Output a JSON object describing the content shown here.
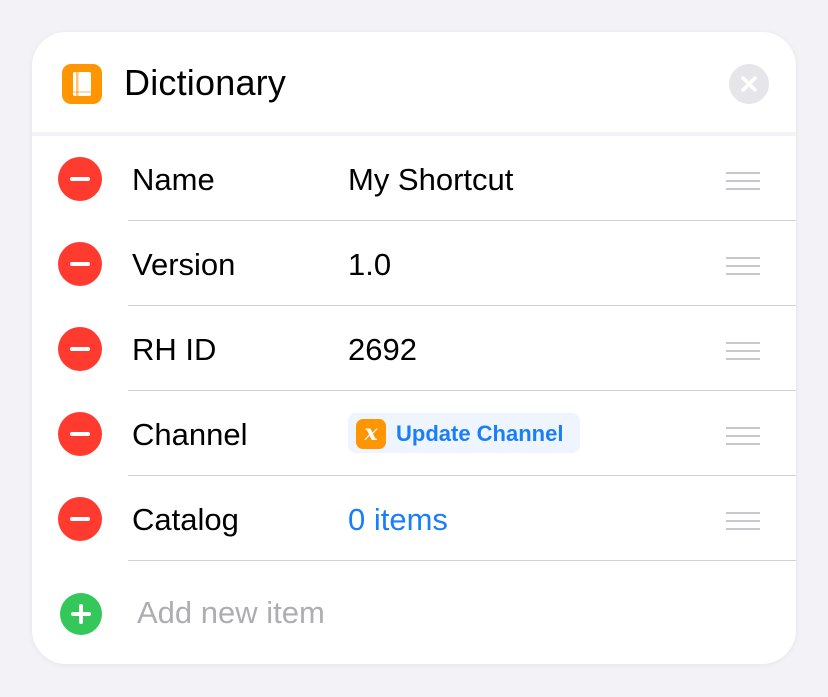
{
  "header": {
    "title": "Dictionary",
    "app_icon": "book-icon",
    "close_icon": "close-icon"
  },
  "rows": [
    {
      "key": "Name",
      "value": "My Shortcut",
      "value_style": "text"
    },
    {
      "key": "Version",
      "value": "1.0",
      "value_style": "text"
    },
    {
      "key": "RH ID",
      "value": "2692",
      "value_style": "text"
    },
    {
      "key": "Channel",
      "variable": {
        "icon": "x",
        "label": "Update Channel"
      },
      "value_style": "variable"
    },
    {
      "key": "Catalog",
      "value": "0 items",
      "value_style": "link"
    }
  ],
  "add_row": {
    "placeholder": "Add new item"
  },
  "colors": {
    "accent": "#1a7ff7",
    "remove": "#ff3b30",
    "add": "#34c759",
    "app_icon": "#ff9500",
    "background": "#f2f2f7"
  }
}
